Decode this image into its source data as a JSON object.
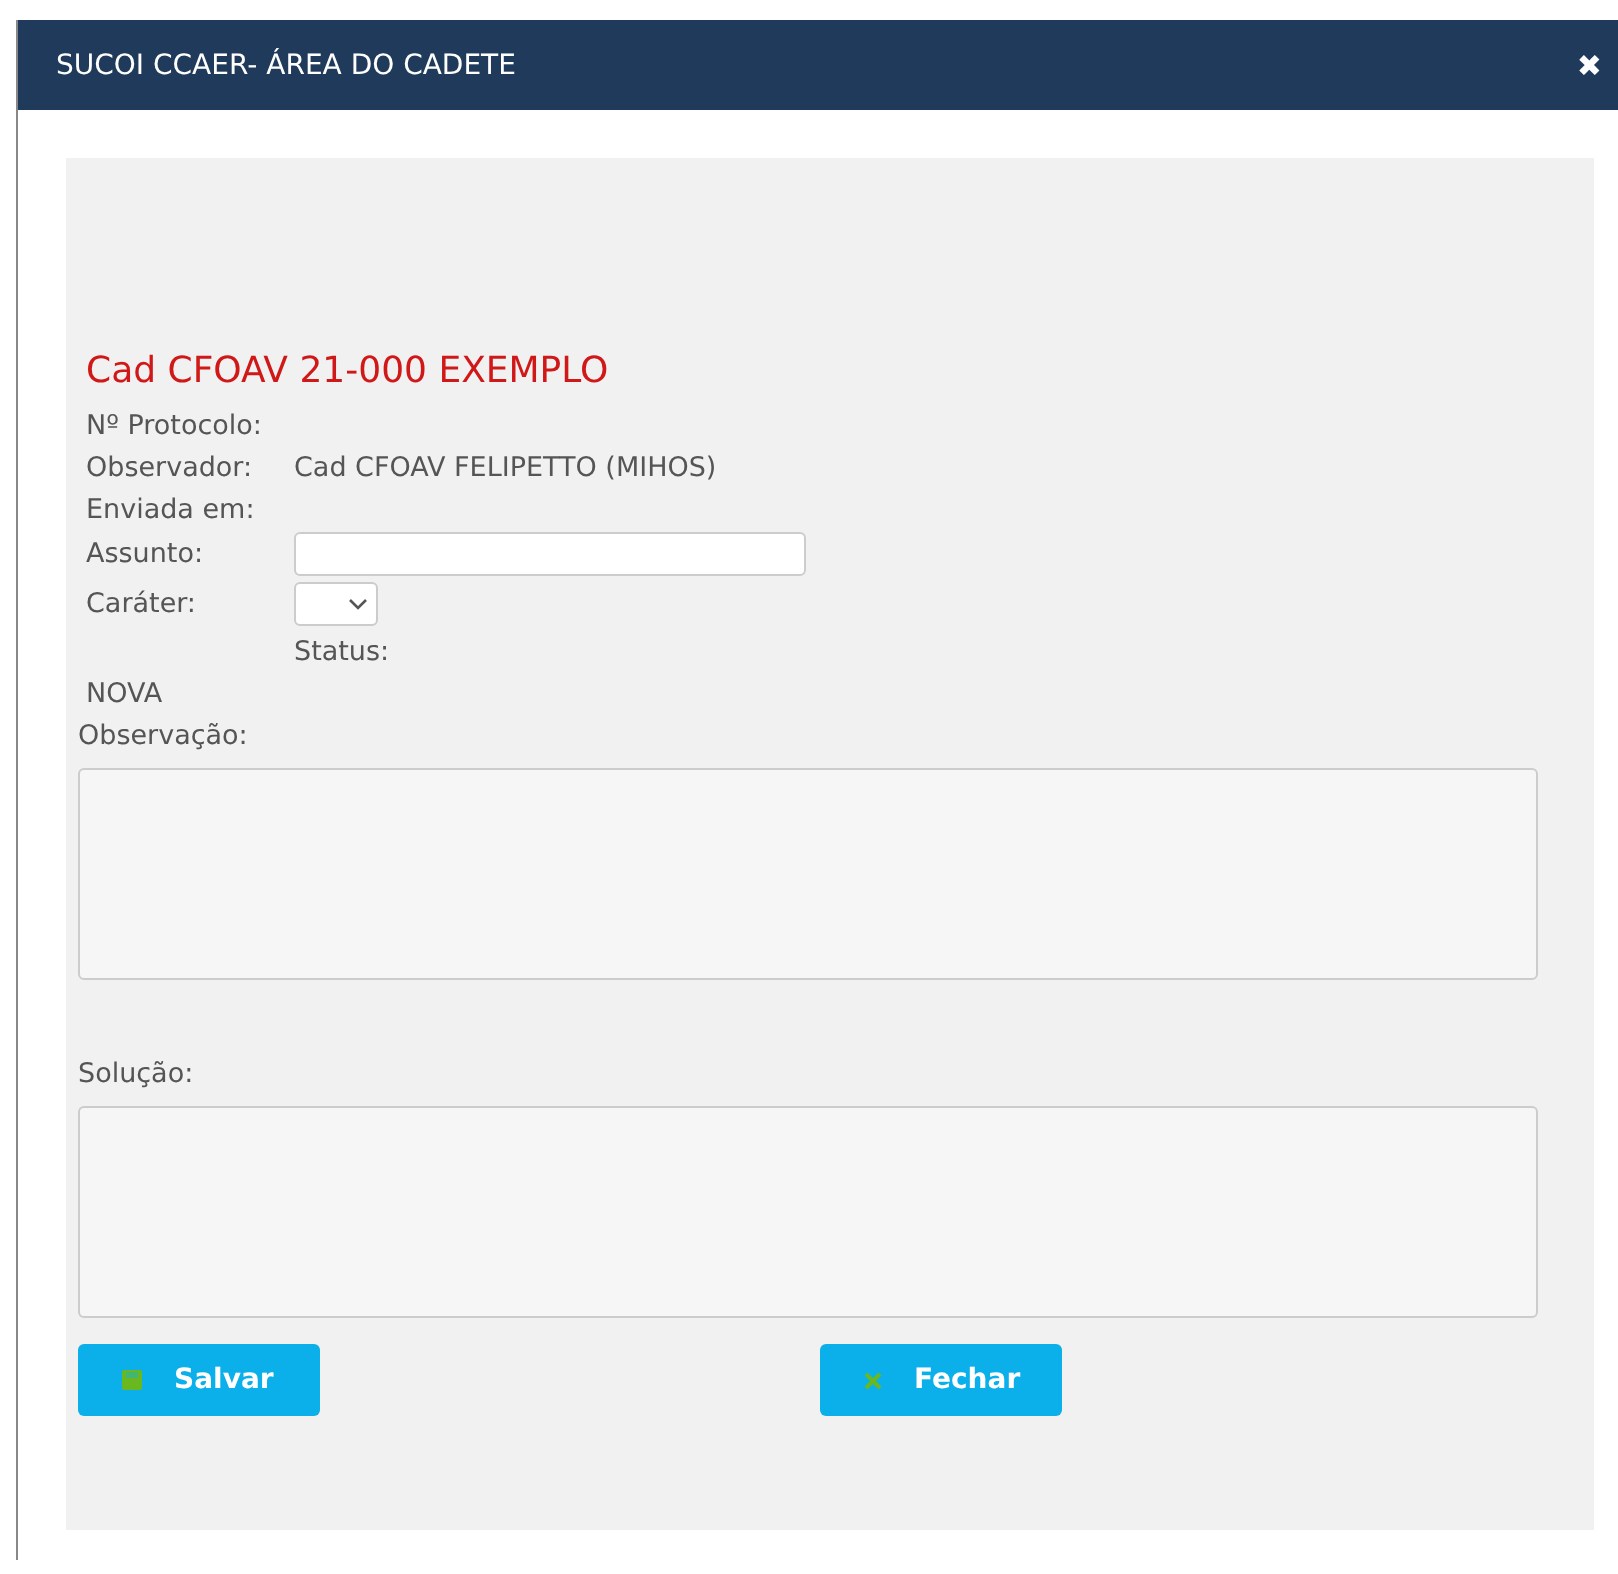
{
  "window": {
    "title": "SUCOI CCAER- ÁREA DO CADETE",
    "close": "✖"
  },
  "heading": "Cad CFOAV 21-000 EXEMPLO",
  "info": [
    {
      "label": "Nº Protocolo:"
    },
    {
      "label": "Observador:",
      "value": "Cad CFOAV FELIPETTO (MIHOS)"
    },
    {
      "label": "Enviada em:"
    }
  ],
  "assunto": {
    "label": "Assunto:"
  },
  "carater": {
    "label": "Caráter:"
  },
  "status": {
    "label": "Status:",
    "value": "NOVA"
  },
  "observacao": {
    "label": "Observação:"
  },
  "solucao": {
    "label": "Solução:"
  },
  "buttons": [
    {
      "label": "Salvar",
      "kind": "save"
    },
    {
      "label": "Fechar",
      "kind": "close"
    }
  ]
}
